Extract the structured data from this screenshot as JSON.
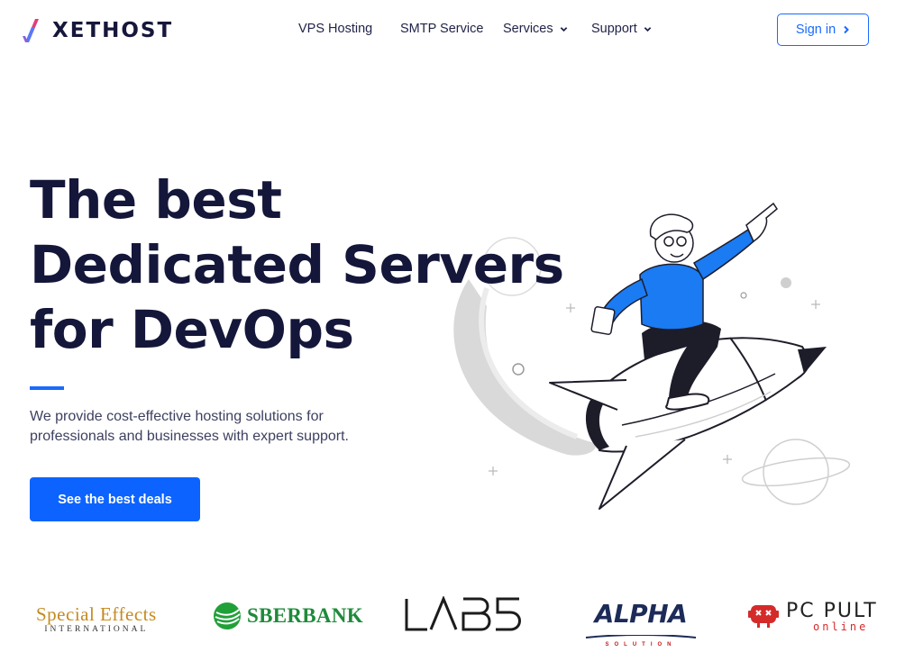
{
  "header": {
    "brand": "XETHOST",
    "nav": [
      {
        "label": "VPS Hosting",
        "has_dropdown": false
      },
      {
        "label": "SMTP Service",
        "has_dropdown": false
      },
      {
        "label": "Services",
        "has_dropdown": true
      },
      {
        "label": "Support",
        "has_dropdown": true
      }
    ],
    "signin_label": "Sign in"
  },
  "hero": {
    "title_lines": [
      "The best",
      "Dedicated Servers",
      "for DevOps"
    ],
    "description_lines": [
      "We provide cost-effective hosting solutions for",
      "professionals and businesses with expert support."
    ],
    "cta_label": "See the best deals"
  },
  "brands": {
    "special_effects": {
      "line1": "Special Effects",
      "line2": "INTERNATIONAL"
    },
    "sberbank": "SBERBANK",
    "lab5": "LAB5",
    "alpha": {
      "name": "ALPHA",
      "sub": "SOLUTION"
    },
    "pcpult": {
      "name": "PC PULT",
      "sub": "online"
    }
  },
  "colors": {
    "primary": "#0d63ff",
    "text_dark": "#14163a",
    "figure_blue": "#1a7bf2"
  }
}
